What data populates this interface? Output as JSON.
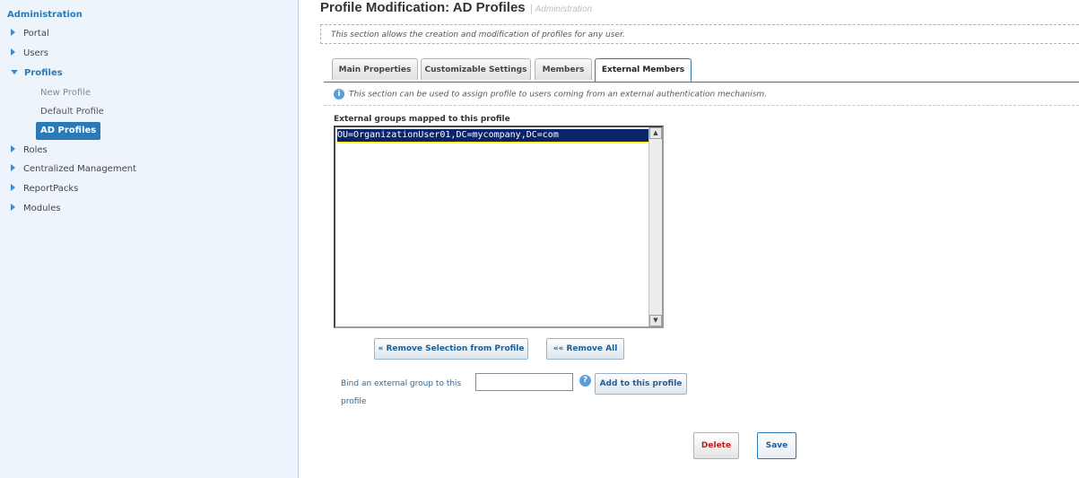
{
  "sidebar": {
    "title": "Administration",
    "items": [
      {
        "label": "Portal"
      },
      {
        "label": "Users"
      },
      {
        "label": "Profiles"
      },
      {
        "label": "Roles"
      },
      {
        "label": "Centralized Management"
      },
      {
        "label": "ReportPacks"
      },
      {
        "label": "Modules"
      }
    ],
    "profile_children": [
      {
        "label": "New Profile"
      },
      {
        "label": "Default Profile"
      },
      {
        "label": "AD Profiles"
      }
    ]
  },
  "header": {
    "title": "Profile Modification: AD Profiles",
    "breadcrumb": "Administration"
  },
  "description": "This section allows the creation and modification of profiles for any user.",
  "tabs": [
    {
      "label": "Main Properties"
    },
    {
      "label": "Customizable Settings"
    },
    {
      "label": "Members"
    },
    {
      "label": "External Members"
    }
  ],
  "active_tab": "External Members",
  "external_members": {
    "info_text": "This section can be used to assign profile to users coming from an external authentication mechanism.",
    "list_label": "External groups mapped to this profile",
    "groups": [
      "OU=OrganizationUser01,DC=mycompany,DC=com"
    ],
    "remove_selection_label": "« Remove Selection from Profile",
    "remove_all_label": "«« Remove All",
    "bind_label": "Bind an external group to this profile",
    "bind_input_value": "",
    "add_label": "Add to this profile"
  },
  "actions": {
    "delete_label": "Delete",
    "save_label": "Save"
  },
  "colors": {
    "accent": "#2a7ab8",
    "sidebar_bg": "#eef4fb",
    "selection_bg": "#0a246a",
    "delete_text": "#c01d1d"
  }
}
